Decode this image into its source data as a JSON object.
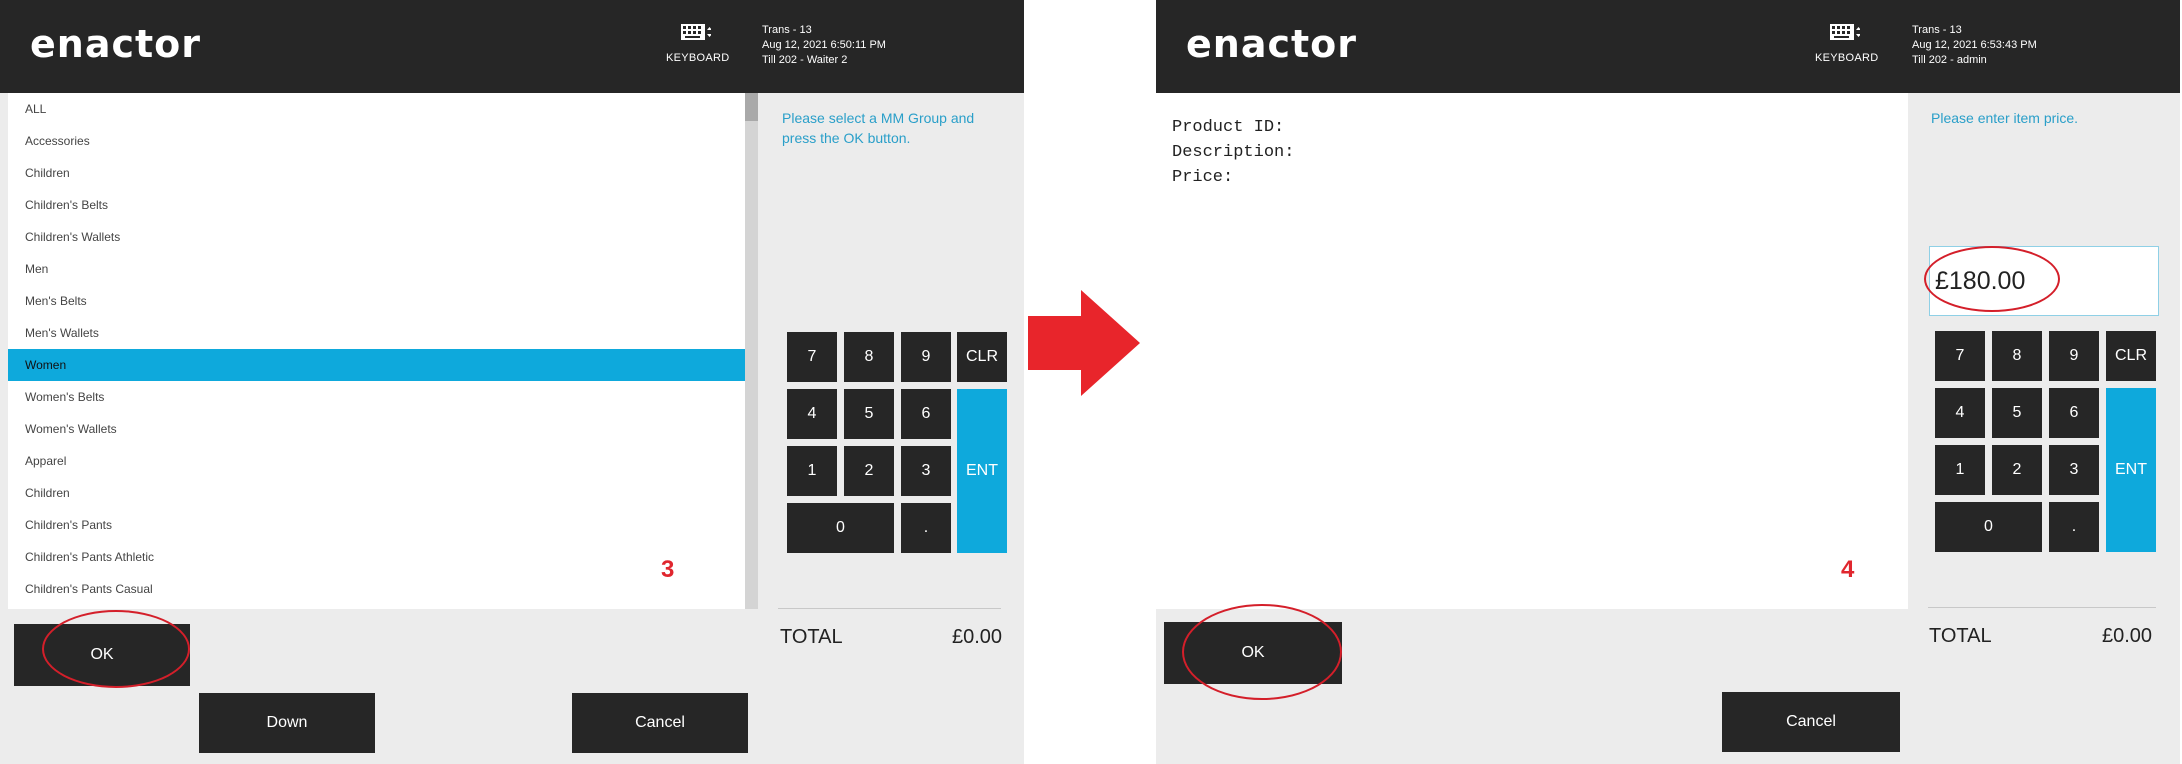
{
  "steps": {
    "left": {
      "header": {
        "logo": "enactor",
        "keyboard_label": "KEYBOARD",
        "trans": "Trans - 13",
        "datetime": "Aug 12, 2021 6:50:11 PM",
        "till": "Till 202 - Waiter 2"
      },
      "list": {
        "items": [
          {
            "label": "ALL"
          },
          {
            "label": "Accessories"
          },
          {
            "label": "Children"
          },
          {
            "label": "Children's Belts"
          },
          {
            "label": "Children's Wallets"
          },
          {
            "label": "Men"
          },
          {
            "label": "Men's Belts"
          },
          {
            "label": "Men's Wallets"
          },
          {
            "label": "Women",
            "selected": true
          },
          {
            "label": "Women's Belts"
          },
          {
            "label": "Women's Wallets"
          },
          {
            "label": "Apparel"
          },
          {
            "label": "Children"
          },
          {
            "label": "Children's Pants"
          },
          {
            "label": "Children's Pants Athletic"
          },
          {
            "label": "Children's Pants Casual"
          }
        ]
      },
      "prompt": "Please select a MM Group and press the OK button.",
      "numpad": {
        "k7": "7",
        "k8": "8",
        "k9": "9",
        "clr": "CLR",
        "k4": "4",
        "k5": "5",
        "k6": "6",
        "k1": "1",
        "k2": "2",
        "k3": "3",
        "k0": "0",
        "dot": ".",
        "ent": "ENT"
      },
      "total_label": "TOTAL",
      "total_value": "£0.00",
      "buttons": {
        "ok": "OK",
        "down": "Down",
        "cancel": "Cancel"
      },
      "step_number": "3"
    },
    "right": {
      "header": {
        "logo": "enactor",
        "keyboard_label": "KEYBOARD",
        "trans": "Trans - 13",
        "datetime": "Aug 12, 2021 6:53:43 PM",
        "till": "Till 202 - admin"
      },
      "product_fields": {
        "product_id": "Product ID:",
        "description": "Description:",
        "price": "Price:"
      },
      "prompt": "Please enter item price.",
      "price_value": "£180.00",
      "numpad": {
        "k7": "7",
        "k8": "8",
        "k9": "9",
        "clr": "CLR",
        "k4": "4",
        "k5": "5",
        "k6": "6",
        "k1": "1",
        "k2": "2",
        "k3": "3",
        "k0": "0",
        "dot": ".",
        "ent": "ENT"
      },
      "total_label": "TOTAL",
      "total_value": "£0.00",
      "buttons": {
        "ok": "OK",
        "cancel": "Cancel"
      },
      "step_number": "4"
    }
  },
  "colors": {
    "header_bg": "#262626",
    "accent": "#0ea9dc",
    "highlight_oval": "#d41f2a",
    "arrow": "#e8252b",
    "step_number": "#e0262e"
  }
}
